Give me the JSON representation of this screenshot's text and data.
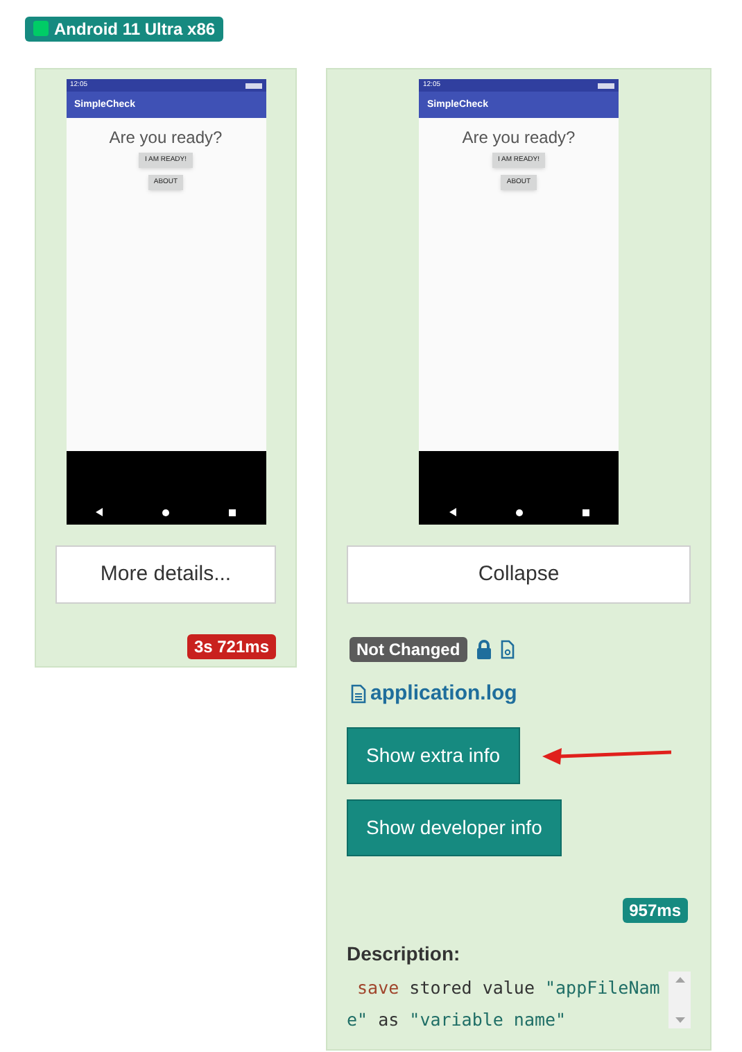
{
  "device_badge": {
    "label": "Android 11 Ultra x86",
    "color": "#00cc66"
  },
  "results": [
    {
      "screenshot": {
        "status_time": "12:05",
        "app_title": "SimpleCheck",
        "heading": "Are you ready?",
        "buttons": [
          "I AM READY!",
          "ABOUT"
        ]
      },
      "toggle_button": "More details...",
      "expanded": false,
      "duration": {
        "text": "3s 721ms",
        "color": "#c9211e"
      }
    },
    {
      "screenshot": {
        "status_time": "12:05",
        "app_title": "SimpleCheck",
        "heading": "Are you ready?",
        "buttons": [
          "I AM READY!",
          "ABOUT"
        ]
      },
      "toggle_button": "Collapse",
      "expanded": true,
      "status_badge": "Not Changed",
      "log_link": "application.log",
      "action_buttons": [
        {
          "label": "Show extra info",
          "highlighted": true
        },
        {
          "label": "Show developer info",
          "highlighted": false
        }
      ],
      "duration": {
        "text": "957ms",
        "color": "#168a80"
      },
      "description": {
        "label": "Description:",
        "code": [
          {
            "kind": "keyword",
            "text": " save"
          },
          {
            "kind": "plain",
            "text": " stored value "
          },
          {
            "kind": "string",
            "text": "\"appFileName\""
          },
          {
            "kind": "plain",
            "text": " as "
          },
          {
            "kind": "string",
            "text": "\"variable name\""
          }
        ]
      }
    }
  ]
}
